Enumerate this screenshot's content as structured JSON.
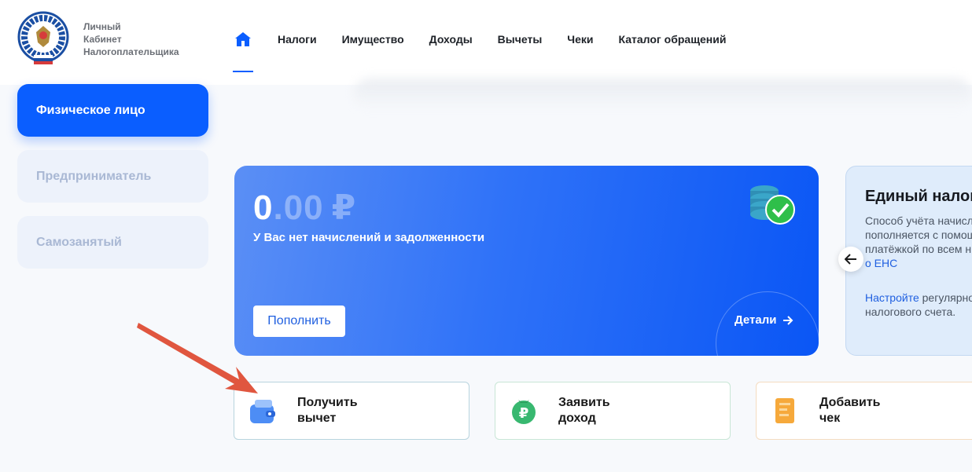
{
  "brand": {
    "lines": [
      "Личный",
      "Кабинет",
      "Налогоплательщика"
    ]
  },
  "nav": {
    "items": [
      "Налоги",
      "Имущество",
      "Доходы",
      "Вычеты",
      "Чеки",
      "Каталог обращений"
    ]
  },
  "sidebar": {
    "items": [
      "Физическое лицо",
      "Предприниматель",
      "Самозанятый"
    ]
  },
  "balance": {
    "whole": "0",
    "decimal": ".00",
    "currency": "₽",
    "status": "У Вас нет начислений и задолженности",
    "topup_label": "Пополнить",
    "details_label": "Детали"
  },
  "ens": {
    "title": "Единый налог",
    "line1": "Способ учёта начисл",
    "line2": "пополняется с помощ",
    "line3": "платёжкой по всем н",
    "line4_link": "о ЕНС",
    "line5_link": "Настройте",
    "line5_rest": " регулярно",
    "line6": "налогового счета."
  },
  "actions": [
    {
      "line1": "Получить",
      "line2": "вычет"
    },
    {
      "line1": "Заявить",
      "line2": "доход"
    },
    {
      "line1": "Добавить",
      "line2": "чек"
    }
  ],
  "colors": {
    "accent": "#0a5eff",
    "annotation_arrow": "#e0563f"
  },
  "icons": {
    "home": "home-icon",
    "coins": "coins-check-icon",
    "wallet": "wallet-icon",
    "income": "ruble-bag-icon",
    "receipt": "receipt-icon"
  }
}
